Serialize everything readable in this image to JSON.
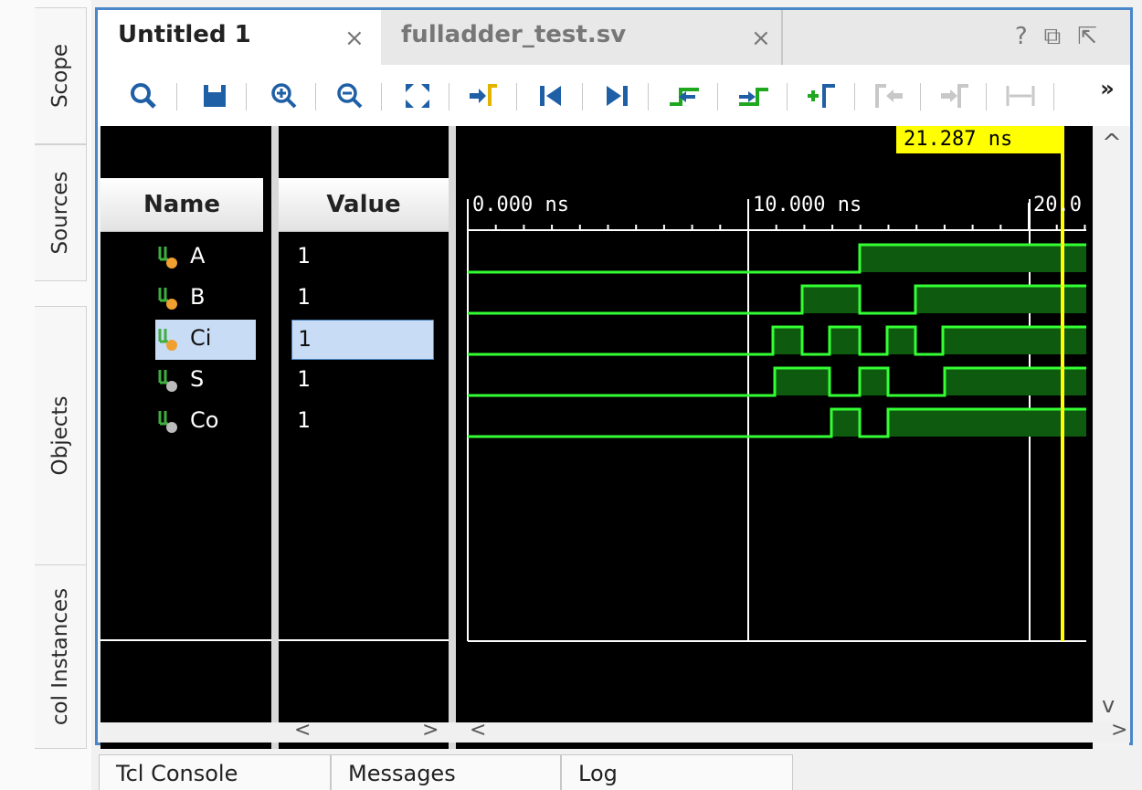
{
  "left_tabs": [
    "Scope",
    "Sources",
    "Objects",
    "col Instances"
  ],
  "tabs": [
    {
      "label": "Untitled 1",
      "close": "×"
    },
    {
      "label": "fulladder_test.sv",
      "close": "×"
    }
  ],
  "window_icons": {
    "help": "?",
    "restore": "⧉",
    "maximize": "⇱"
  },
  "toolbar": {
    "items": [
      "search-icon",
      "save-icon",
      "zoom-in-icon",
      "zoom-out-icon",
      "zoom-fit-icon",
      "go-to-cursor-icon",
      "go-to-time-zero-icon",
      "go-to-last-time-icon",
      "previous-transition-icon",
      "next-transition-icon",
      "add-marker-icon",
      "previous-marker-icon",
      "next-marker-icon",
      "swap-cursors-icon"
    ],
    "overflow": "»"
  },
  "columns": {
    "name": "Name",
    "value": "Value"
  },
  "signals": [
    {
      "name": "A",
      "value": "1",
      "kind": "input"
    },
    {
      "name": "B",
      "value": "1",
      "kind": "input"
    },
    {
      "name": "Ci",
      "value": "1",
      "kind": "input"
    },
    {
      "name": "S",
      "value": "1",
      "kind": "output"
    },
    {
      "name": "Co",
      "value": "1",
      "kind": "output"
    }
  ],
  "timeline": {
    "labels": [
      "0.000 ns",
      "10.000 ns",
      "20.0"
    ],
    "cursor": "21.287 ns"
  },
  "scroll": {
    "left": "<",
    "right": ">",
    "up": "^",
    "down": "v"
  },
  "bottom_tabs": [
    "Tcl Console",
    "Messages",
    "Log"
  ],
  "colors": {
    "accent": "#4a86c8",
    "wave": "#33ff33",
    "wave_fill": "#0e5a0e",
    "cursor": "#ffff00",
    "selection": "#c8dcf5"
  }
}
